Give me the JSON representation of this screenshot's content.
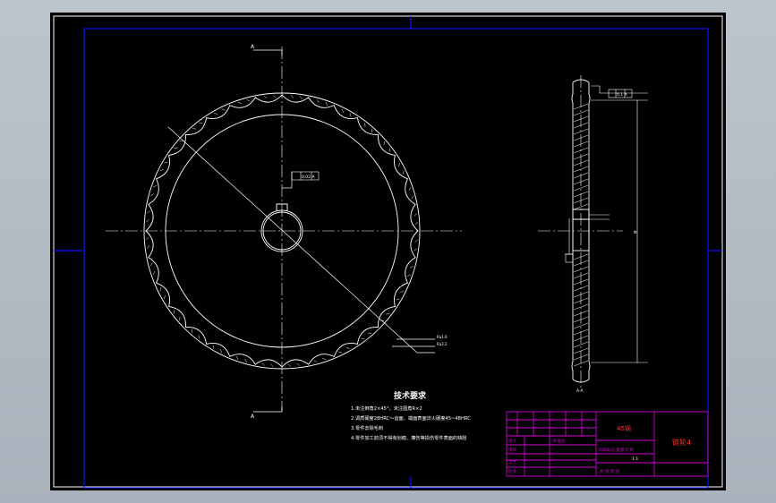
{
  "drawing": {
    "technical_requirements": {
      "title": "技术要求",
      "items": [
        "1.未注倒角2×45°，未注圆角R×2",
        "2.调质硬度28HRC～齿面、端面表面淬火硬度45~48HRC",
        "3.零件去除毛刺",
        "4.零件加工前须不得有划痕、擦伤等损伤零件表面的缺陷"
      ]
    },
    "title_block": {
      "material": "45钢",
      "part_name": "链轮4",
      "row_labels": [
        "设计",
        "审核",
        "工艺",
        "批准"
      ],
      "columns_label": "阶段标记 重量 比例",
      "scale": "1:1",
      "sheet_label": "共  张 第  张",
      "standard": "标准化"
    },
    "labels": {
      "section_a_top": "A",
      "section_a_bottom": "A",
      "section_view": "A-A",
      "tolerance_key": "0.02 A",
      "tolerance_rim": "0.1 A",
      "tol_r1": "Ra1.6",
      "tol_r2": "Ra3.2",
      "side_dim": "Φ"
    },
    "colors": {
      "background": "#000000",
      "frame": "#1010ff",
      "lines": "#ffffff",
      "title_block": "#d000d0",
      "title_text": "#ff3030"
    }
  }
}
